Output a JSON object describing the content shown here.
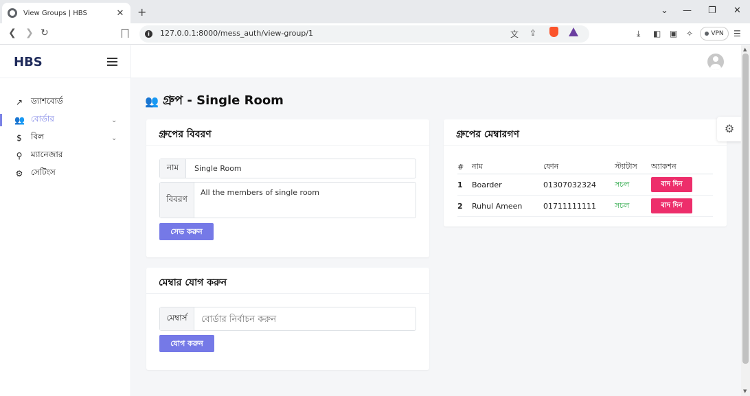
{
  "browser": {
    "tab_title": "View Groups | HBS",
    "tab_close": "✕",
    "new_tab": "+",
    "url": "127.0.0.1:8000/mess_auth/view-group/1",
    "vpn": "VPN",
    "controls": {
      "chevron": "⌄",
      "minimize": "—",
      "restore": "❐",
      "close": "✕"
    }
  },
  "sidebar": {
    "brand": "HBS",
    "items": [
      {
        "label": "ড্যাশবোর্ড",
        "icon": "trend-up-icon",
        "glyph": "↗",
        "active": false,
        "expandable": false
      },
      {
        "label": "বোর্ডার",
        "icon": "users-icon",
        "glyph": "👥",
        "active": true,
        "expandable": true
      },
      {
        "label": "বিল",
        "icon": "dollar-icon",
        "glyph": "$",
        "active": false,
        "expandable": true
      },
      {
        "label": "ম্যানেজার",
        "icon": "user-check-icon",
        "glyph": "⚲",
        "active": false,
        "expandable": false
      },
      {
        "label": "সেটিংস",
        "icon": "gear-icon",
        "glyph": "⚙",
        "active": false,
        "expandable": false
      }
    ]
  },
  "page": {
    "title": "গ্রুপ - Single Room"
  },
  "details_card": {
    "title": "গ্রুপের বিবরণ",
    "name_label": "নাম",
    "name_value": "Single Room",
    "desc_label": "বিবরণ",
    "desc_value": "All the members of single room",
    "save_label": "সেভ করুন"
  },
  "add_card": {
    "title": "মেম্বার যোগ করুন",
    "member_label": "মেম্বার্স",
    "member_placeholder": "বোর্ডার নির্বাচন করুন",
    "add_label": "যোগ করুন"
  },
  "members_card": {
    "title": "গ্রুপের মেম্বারগণ",
    "columns": [
      "#",
      "নাম",
      "ফোন",
      "স্ট্যাটাস",
      "অ্যাকশন"
    ],
    "rows": [
      {
        "num": "1",
        "name": "Boarder",
        "phone": "01307032324",
        "status": "সচল",
        "action": "বাদ দিন"
      },
      {
        "num": "2",
        "name": "Ruhul Ameen",
        "phone": "01711111111",
        "status": "সচল",
        "action": "বাদ দিন"
      }
    ]
  },
  "colors": {
    "accent": "#7579e7",
    "danger": "#ed2e6b",
    "success": "#28a745",
    "brand": "#1e2a5a"
  }
}
